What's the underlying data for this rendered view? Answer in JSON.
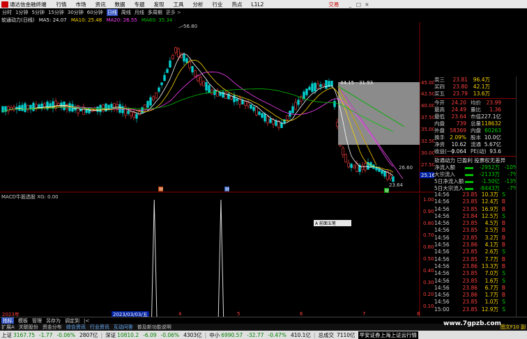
{
  "menubar": {
    "app_name": "通达信金融终端",
    "items": [
      "行情",
      "市场",
      "资讯",
      "数据",
      "专题",
      "发现",
      "工具",
      "分析",
      "行业",
      "热点",
      "L1L2"
    ],
    "trade": "交易",
    "win_buttons": [
      "_",
      "□",
      "×"
    ]
  },
  "period_bar": {
    "items": [
      "分时",
      "1分钟",
      "5分钟",
      "15分钟",
      "30分钟",
      "60分钟",
      "日线",
      "周线",
      "月线",
      "多周期"
    ],
    "active_index": 6,
    "more": "更多 >"
  },
  "ma_legend": {
    "title": "软通动力(日线)",
    "ma5": "MA5: 24.07",
    "ma10": "MA10: 25.48",
    "ma20": "MA20: 26.55",
    "ma60": "MA60: 35.34"
  },
  "chart_labels": {
    "high_label": "56.80",
    "box_label": "44.15 - 31.93",
    "right_label": "26.60",
    "low_label": "23.64",
    "cur_price": "25.16",
    "mark_cai1": "财",
    "mark_cai2": "财",
    "mark_3": "财"
  },
  "axis_main": [
    "45.00",
    "42.50",
    "40.00",
    "37.50",
    "35.00",
    "32.50",
    "30.00",
    "27.50",
    "25.00"
  ],
  "axis_macd": [
    "1.00",
    "0.90",
    "0.80",
    "0.70",
    "0.60",
    "0.50",
    "0.40",
    "0.30",
    "0.20",
    "0.10",
    "0.00"
  ],
  "macd_legend": "MACD牛股选股  XG: 0.00",
  "date_axis": {
    "left": "2023年",
    "cursor": "2023/03/03/五",
    "ticks": [
      "4",
      "5",
      "6",
      "7",
      "8"
    ]
  },
  "mini_widget": "A 前面五笔",
  "quote": {
    "asks": [
      {
        "label": "卖三",
        "price": "23.81",
        "vol": "96.4万"
      },
      {
        "label": "买四",
        "price": "23.80",
        "vol": "42.1万"
      },
      {
        "label": "买五",
        "price": "23.79",
        "vol": "13.6万"
      }
    ],
    "stats": [
      {
        "k": "今开",
        "v": "24.20",
        "vc": "red",
        "k2": "均价",
        "v2": "23.99",
        "v2c": "red"
      },
      {
        "k": "最高",
        "v": "24.49",
        "vc": "red",
        "k2": "量比",
        "v2": "1.36",
        "v2c": "red"
      },
      {
        "k": "最低",
        "v": "23.64",
        "vc": "red",
        "k2": "市值",
        "v2": "227.1亿",
        "v2c": "wht"
      },
      {
        "k": "内盘",
        "v": "739",
        "vc": "red",
        "k2": "总量",
        "v2": "118632",
        "v2c": "yel"
      },
      {
        "k": "外盘",
        "v": "58369",
        "vc": "red",
        "k2": "内盘",
        "v2": "60263",
        "v2c": "grn"
      },
      {
        "k": "换手",
        "v": "2.09%",
        "vc": "yel",
        "k2": "股本",
        "v2": "10.0亿",
        "v2c": "wht"
      },
      {
        "k": "净资",
        "v": "10.62",
        "vc": "wht",
        "k2": "流通",
        "v2": "5.67亿",
        "v2c": "wht"
      },
      {
        "k": "收益(一)",
        "v": "0.064",
        "vc": "wht",
        "k2": "PE(动)",
        "v2": "93.6",
        "v2c": "wht"
      }
    ],
    "flow_title": "软通动力 已盈利 投票权无差异",
    "flows": [
      {
        "label": "净流入额",
        "value": "-2952万",
        "pct": "-10%"
      },
      {
        "label": "大宗流入",
        "value": "-2133万",
        "pct": "-7%"
      },
      {
        "label": "5日净流入额",
        "value": "-1.50亿",
        "pct": "-13%"
      },
      {
        "label": "5日大宗流入",
        "value": "-8443万",
        "pct": "-7%"
      }
    ]
  },
  "ticks": [
    {
      "t": "14:56",
      "p": "23.85",
      "v": "10.3万",
      "d": "S",
      "dc": "grn"
    },
    {
      "t": "14:56",
      "p": "23.85",
      "v": "12.4万",
      "d": "B",
      "dc": "red"
    },
    {
      "t": "14:56",
      "p": "23.85",
      "v": "16.9万",
      "d": "B",
      "dc": "red"
    },
    {
      "t": "14:56",
      "p": "23.84",
      "v": "12.5万",
      "d": "S",
      "dc": "grn"
    },
    {
      "t": "14:56",
      "p": "23.85",
      "v": "4.5万",
      "d": "B",
      "dc": "red"
    },
    {
      "t": "14:56",
      "p": "23.85",
      "v": "2.5万",
      "d": "B",
      "dc": "red"
    },
    {
      "t": "14:56",
      "p": "23.85",
      "v": "3.2万",
      "d": "B",
      "dc": "red"
    },
    {
      "t": "14:56",
      "p": "23.86",
      "v": "4.1万",
      "d": "B",
      "dc": "red"
    },
    {
      "t": "14:56",
      "p": "23.85",
      "v": "2.6万",
      "d": "S",
      "dc": "grn"
    },
    {
      "t": "14:56",
      "p": "23.85",
      "v": "7.7万",
      "d": "B",
      "dc": "red"
    },
    {
      "t": "14:56",
      "p": "23.86",
      "v": "13.3万",
      "d": "B",
      "dc": "red"
    },
    {
      "t": "14:56",
      "p": "23.85",
      "v": "7.0万",
      "d": "S",
      "dc": "grn"
    },
    {
      "t": "14:56",
      "p": "23.85",
      "v": "1.6万",
      "d": "S",
      "dc": "grn"
    },
    {
      "t": "14:56",
      "p": "23.86",
      "v": "6.7万",
      "d": "B",
      "dc": "red"
    },
    {
      "t": "14:56",
      "p": "23.86",
      "v": "1.7万",
      "d": "B",
      "dc": "red"
    },
    {
      "t": "14:56",
      "p": "23.85",
      "v": "1.0万",
      "d": "S",
      "dc": "grn"
    },
    {
      "t": "15:00",
      "p": "23.85",
      "v": "12.9万",
      "d": "S",
      "dc": "grn"
    }
  ],
  "tabbar": {
    "items": [
      "指标",
      "模板",
      "管理",
      "另存为",
      "调定到",
      "|<"
    ],
    "active_index": 0
  },
  "tabbar2": {
    "items": [
      "扩展A",
      "关联股份",
      "资金分布",
      "综合资讯",
      "行业资讯",
      "互动问答",
      "普及新功能说明"
    ],
    "blue_indices": [
      3,
      4,
      5
    ],
    "right": "图文F10 副"
  },
  "statusbar": [
    {
      "name": "上证",
      "value": "3167.75",
      "chg": "-1.77",
      "pct": "-0.06%",
      "amt": "2807亿"
    },
    {
      "name": "深证",
      "value": "10810.2",
      "chg": "-6.09",
      "pct": "-0.06%",
      "amt": "4303亿"
    },
    {
      "name": "中小",
      "value": "6990.57",
      "chg": "-32.77",
      "pct": "-0.47%",
      "amt": "410.1亿"
    }
  ],
  "status_extra": {
    "label": "总成交",
    "amt": "7110亿",
    "news": "平安证券上海上证云行情"
  },
  "watermark": "www.7gpzb.com",
  "colors": {
    "up": "#ff4040",
    "down": "#00d0d0",
    "ma5": "#ffffff",
    "ma10": "#ffd700",
    "ma20": "#ff40ff",
    "ma60": "#00c000"
  },
  "chart_data": [
    {
      "type": "candlestick",
      "title": "软通动力(日线)",
      "ylim": [
        22.5,
        46
      ],
      "axis_ticks": [
        25,
        27.5,
        30,
        32.5,
        35,
        37.5,
        40,
        42.5,
        45
      ],
      "annotations": {
        "high": 56.8,
        "box": [
          44.15,
          31.93
        ],
        "target": 26.6,
        "low": 23.64,
        "last": 25.16
      },
      "series": [
        {
          "name": "MA5",
          "values": [
            24.07
          ]
        },
        {
          "name": "MA10",
          "values": [
            25.48
          ]
        },
        {
          "name": "MA20",
          "values": [
            26.55
          ]
        },
        {
          "name": "MA60",
          "values": [
            35.34
          ]
        }
      ]
    },
    {
      "type": "line",
      "title": "MACD牛股选股",
      "ylim": [
        0,
        1
      ],
      "series": [
        {
          "name": "XG",
          "values": [
            0.0
          ]
        }
      ],
      "signals": [
        0.37,
        0.53
      ]
    }
  ]
}
